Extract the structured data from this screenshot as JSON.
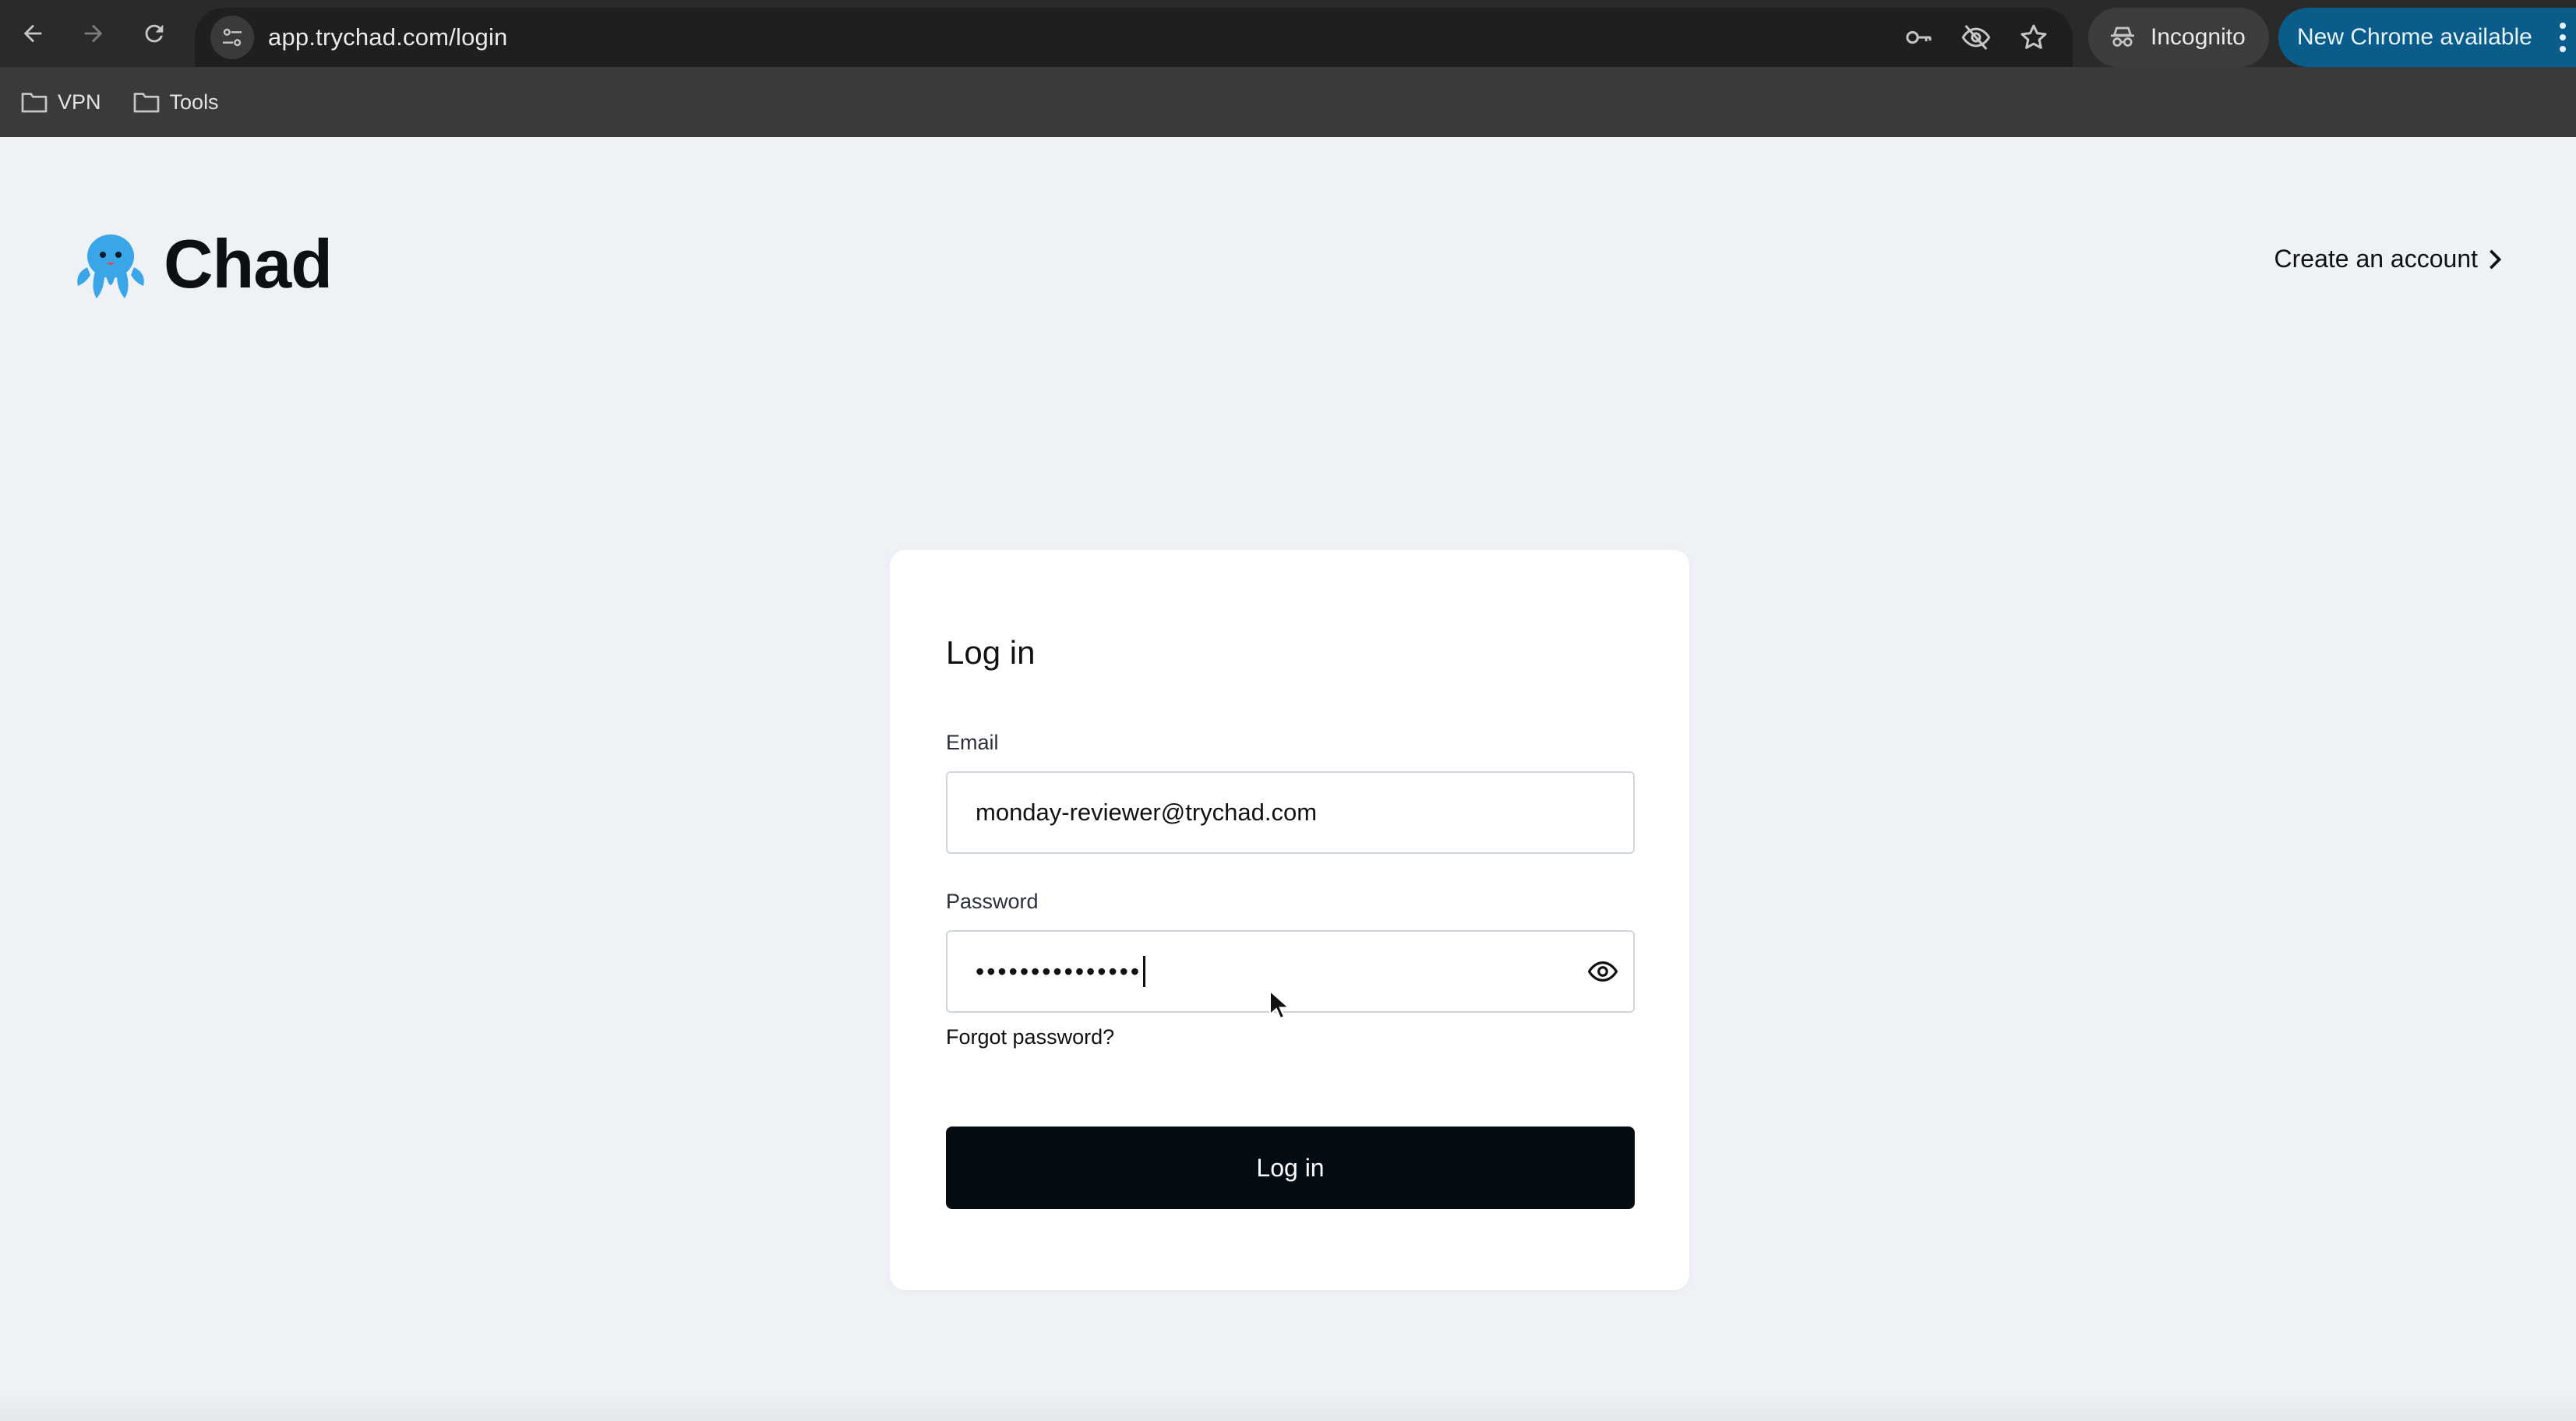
{
  "browser": {
    "url": "app.trychad.com/login",
    "incognito_label": "Incognito",
    "update_label": "New Chrome available",
    "bookmarks": [
      "VPN",
      "Tools"
    ],
    "icons": [
      "back-icon",
      "forward-icon",
      "reload-icon",
      "site-settings-icon",
      "key-icon",
      "eye-off-icon",
      "star-icon",
      "incognito-icon",
      "more-icon",
      "folder-icon"
    ]
  },
  "header": {
    "brand": "Chad",
    "create_account": "Create an account"
  },
  "login": {
    "title": "Log in",
    "email_label": "Email",
    "email_value": "monday-reviewer@trychad.com",
    "password_label": "Password",
    "password_value": "•••••••••••••••",
    "forgot": "Forgot password?",
    "submit": "Log in"
  },
  "colors": {
    "page_bg": "#eef1f6",
    "button_bg": "#050d14",
    "logo_blue": "#3aa6e8",
    "update_chip": "#0a5c8a"
  }
}
